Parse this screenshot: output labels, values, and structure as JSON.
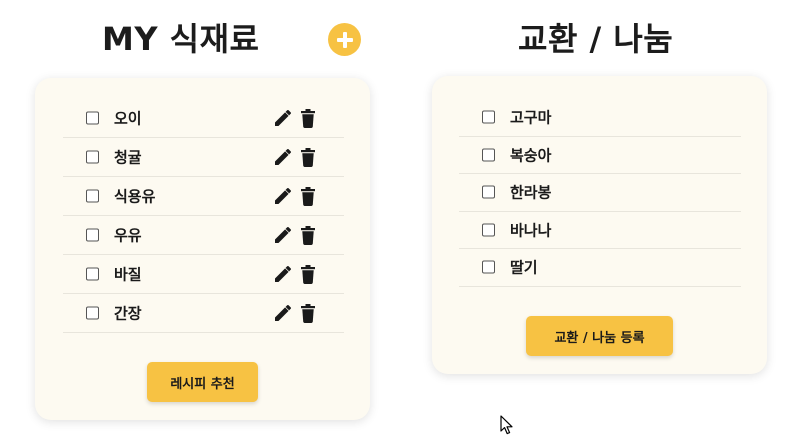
{
  "my_ingredients": {
    "title": "MY 식재료",
    "items": [
      {
        "label": "오이"
      },
      {
        "label": "청귤"
      },
      {
        "label": "식용유"
      },
      {
        "label": "우유"
      },
      {
        "label": "바질"
      },
      {
        "label": "간장"
      }
    ],
    "recommend_button": "레시피 추천"
  },
  "exchange": {
    "title": "교환 / 나눔",
    "items": [
      {
        "label": "고구마"
      },
      {
        "label": "복숭아"
      },
      {
        "label": "한라봉"
      },
      {
        "label": "바나나"
      },
      {
        "label": "딸기"
      }
    ],
    "register_button": "교환 / 나눔 등록"
  },
  "icons": {
    "add": "plus-icon",
    "edit": "pencil-icon",
    "delete": "trash-icon",
    "cursor": "mouse-pointer"
  },
  "colors": {
    "accent": "#f7c243",
    "card_background": "#fdfaf1",
    "text": "#1a1a1a"
  }
}
